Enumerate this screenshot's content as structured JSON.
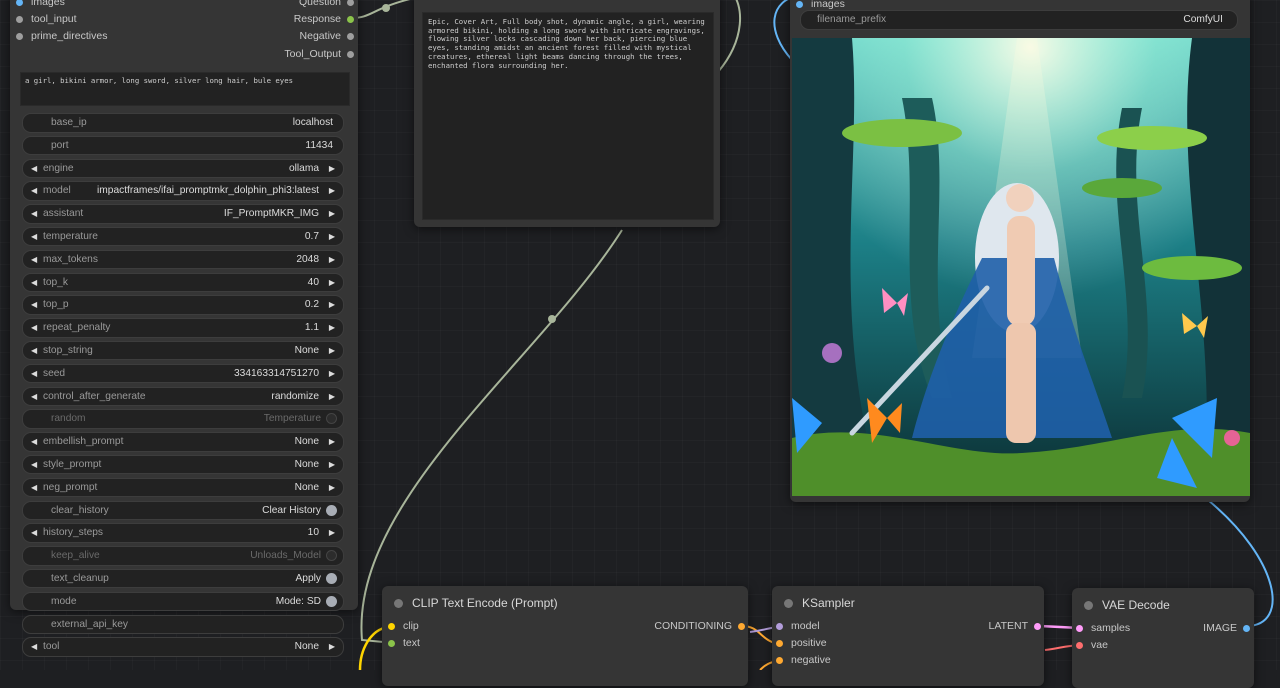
{
  "canvas": {
    "wire_colors": {
      "text": "#a8b59a",
      "image": "#64b5f6",
      "clip": "#ffd500",
      "conditioning": "#ffa931",
      "latent": "#ff9cf9",
      "vae": "#ff6e6e",
      "model": "#b39ddb"
    }
  },
  "prompt_node": {
    "inputs": [
      {
        "label": "images",
        "color": "#64b5f6"
      },
      {
        "label": "tool_input",
        "color": "#9e9e9e"
      },
      {
        "label": "prime_directives",
        "color": "#9e9e9e"
      }
    ],
    "outputs": [
      {
        "label": "Question",
        "color": "#9e9e9e"
      },
      {
        "label": "Response",
        "color": "#8bc34a"
      },
      {
        "label": "Negative",
        "color": "#9e9e9e"
      },
      {
        "label": "Tool_Output",
        "color": "#9e9e9e"
      }
    ],
    "prompt_text": "a girl, bikini armor, long sword, silver long hair, bule eyes",
    "widgets": [
      {
        "label": "base_ip",
        "value": "localhost"
      },
      {
        "label": "port",
        "value": "11434"
      },
      {
        "label": "engine",
        "value": "ollama"
      },
      {
        "label": "model",
        "value": "impactframes/ifai_promptmkr_dolphin_phi3:latest"
      },
      {
        "label": "assistant",
        "value": "IF_PromptMKR_IMG"
      },
      {
        "label": "temperature",
        "value": "0.7"
      },
      {
        "label": "max_tokens",
        "value": "2048"
      },
      {
        "label": "top_k",
        "value": "40"
      },
      {
        "label": "top_p",
        "value": "0.2"
      },
      {
        "label": "repeat_penalty",
        "value": "1.1"
      },
      {
        "label": "stop_string",
        "value": "None"
      },
      {
        "label": "seed",
        "value": "334163314751270"
      },
      {
        "label": "control_after_generate",
        "value": "randomize"
      },
      {
        "label": "random",
        "value": "Temperature"
      },
      {
        "label": "embellish_prompt",
        "value": "None"
      },
      {
        "label": "style_prompt",
        "value": "None"
      },
      {
        "label": "neg_prompt",
        "value": "None"
      },
      {
        "label": "clear_history",
        "value": "Clear History"
      },
      {
        "label": "history_steps",
        "value": "10"
      },
      {
        "label": "keep_alive",
        "value": "Unloads_Model"
      },
      {
        "label": "text_cleanup",
        "value": "Apply"
      },
      {
        "label": "mode",
        "value": "Mode: SD"
      },
      {
        "label": "external_api_key",
        "value": ""
      },
      {
        "label": "tool",
        "value": "None"
      }
    ]
  },
  "display_node": {
    "text": "Epic, Cover Art, Full body shot, dynamic angle, a girl, wearing armored bikini, holding a long sword with intricate engravings, flowing silver locks cascading down her back, piercing blue eyes, standing amidst an ancient forest filled with mystical creatures, ethereal light beams dancing through the trees, enchanted flora surrounding her."
  },
  "save_node": {
    "input_label": "images",
    "filename_prefix_label": "filename_prefix",
    "filename_prefix_value": "ComfyUI"
  },
  "clip_node": {
    "title": "CLIP Text Encode (Prompt)",
    "inputs": [
      {
        "label": "clip",
        "color": "#ffd500"
      },
      {
        "label": "text",
        "color": "#8bc34a"
      }
    ],
    "output": {
      "label": "CONDITIONING",
      "color": "#ffa931"
    }
  },
  "ksampler_node": {
    "title": "KSampler",
    "inputs": [
      {
        "label": "model",
        "color": "#b39ddb"
      },
      {
        "label": "positive",
        "color": "#ffa931"
      },
      {
        "label": "negative",
        "color": "#ffa931"
      }
    ],
    "output": {
      "label": "LATENT",
      "color": "#ff9cf9"
    }
  },
  "vae_node": {
    "title": "VAE Decode",
    "inputs": [
      {
        "label": "samples",
        "color": "#ff9cf9"
      },
      {
        "label": "vae",
        "color": "#ff6e6e"
      }
    ],
    "output": {
      "label": "IMAGE",
      "color": "#64b5f6"
    }
  }
}
